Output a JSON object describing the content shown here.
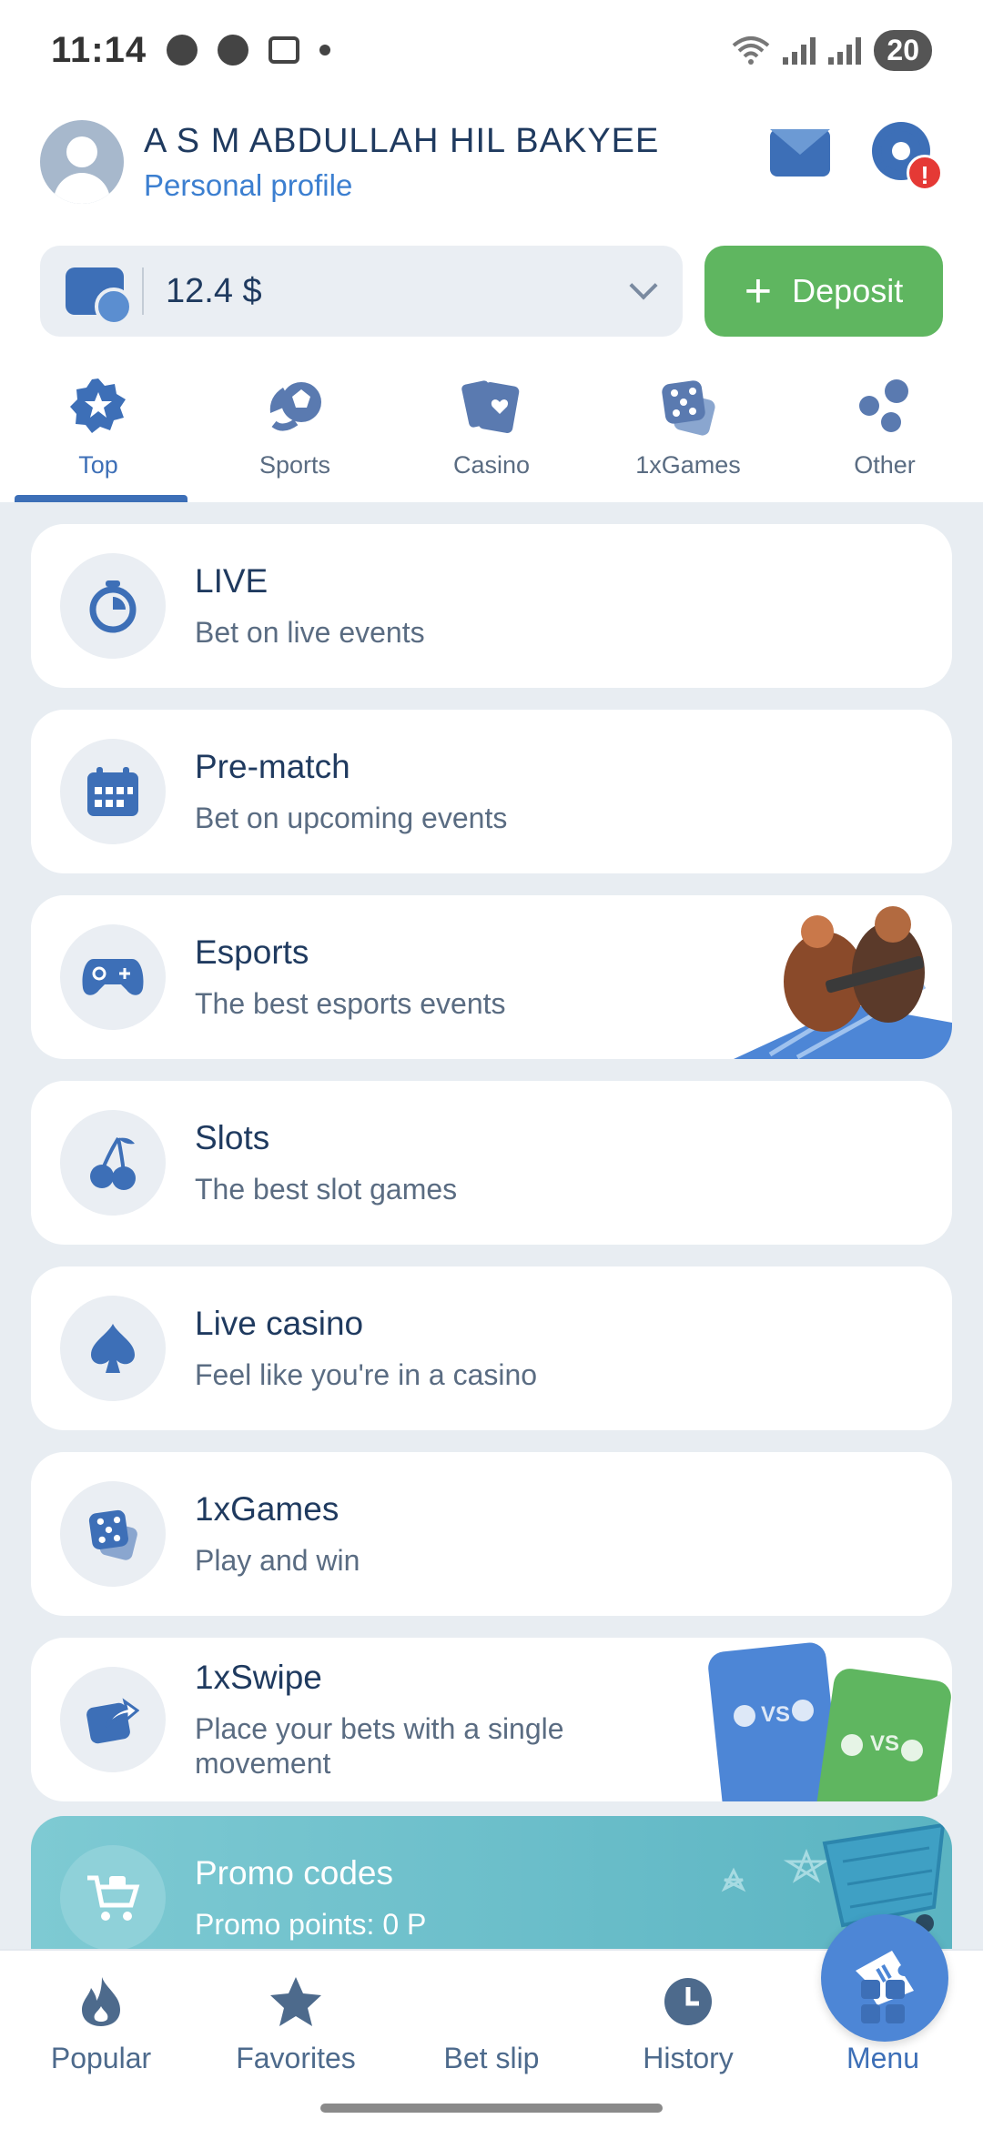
{
  "status_bar": {
    "time": "11:14",
    "battery": "20"
  },
  "profile": {
    "name": "A S M ABDULLAH HIL BAKYEE",
    "subtitle": "Personal profile",
    "settings_badge": "!"
  },
  "balance": {
    "value": "12.4 $",
    "deposit_label": "Deposit"
  },
  "tabs": [
    {
      "label": "Top",
      "icon": "star-badge-icon",
      "active": true
    },
    {
      "label": "Sports",
      "icon": "sports-ball-icon"
    },
    {
      "label": "Casino",
      "icon": "cards-icon"
    },
    {
      "label": "1xGames",
      "icon": "dice-icon"
    },
    {
      "label": "Other",
      "icon": "dots-icon"
    }
  ],
  "items": [
    {
      "title": "LIVE",
      "subtitle": "Bet on live events",
      "icon": "stopwatch-icon"
    },
    {
      "title": "Pre-match",
      "subtitle": "Bet on upcoming events",
      "icon": "calendar-icon"
    },
    {
      "title": "Esports",
      "subtitle": "The best esports events",
      "icon": "gamepad-icon"
    },
    {
      "title": "Slots",
      "subtitle": "The best slot games",
      "icon": "cherries-icon"
    },
    {
      "title": "Live casino",
      "subtitle": "Feel like you're in a casino",
      "icon": "spade-icon"
    },
    {
      "title": "1xGames",
      "subtitle": "Play and win",
      "icon": "dice-icon"
    },
    {
      "title": "1xSwipe",
      "subtitle": "Place your bets with a single movement",
      "icon": "swipe-icon",
      "art_text": "VS"
    },
    {
      "title": "Promo codes",
      "subtitle": "Promo points: 0 P",
      "icon": "cart-icon"
    }
  ],
  "bottom_nav": [
    {
      "label": "Popular",
      "icon": "flame-icon"
    },
    {
      "label": "Favorites",
      "icon": "star-icon"
    },
    {
      "label": "Bet slip",
      "icon": "ticket-icon"
    },
    {
      "label": "History",
      "icon": "clock-icon"
    },
    {
      "label": "Menu",
      "icon": "grid-icon",
      "active": true
    }
  ],
  "colors": {
    "accent": "#3d6fb7",
    "deposit": "#5fb660",
    "background": "#e8edf2",
    "promo": "#6bbfcb",
    "badge": "#e53935"
  }
}
